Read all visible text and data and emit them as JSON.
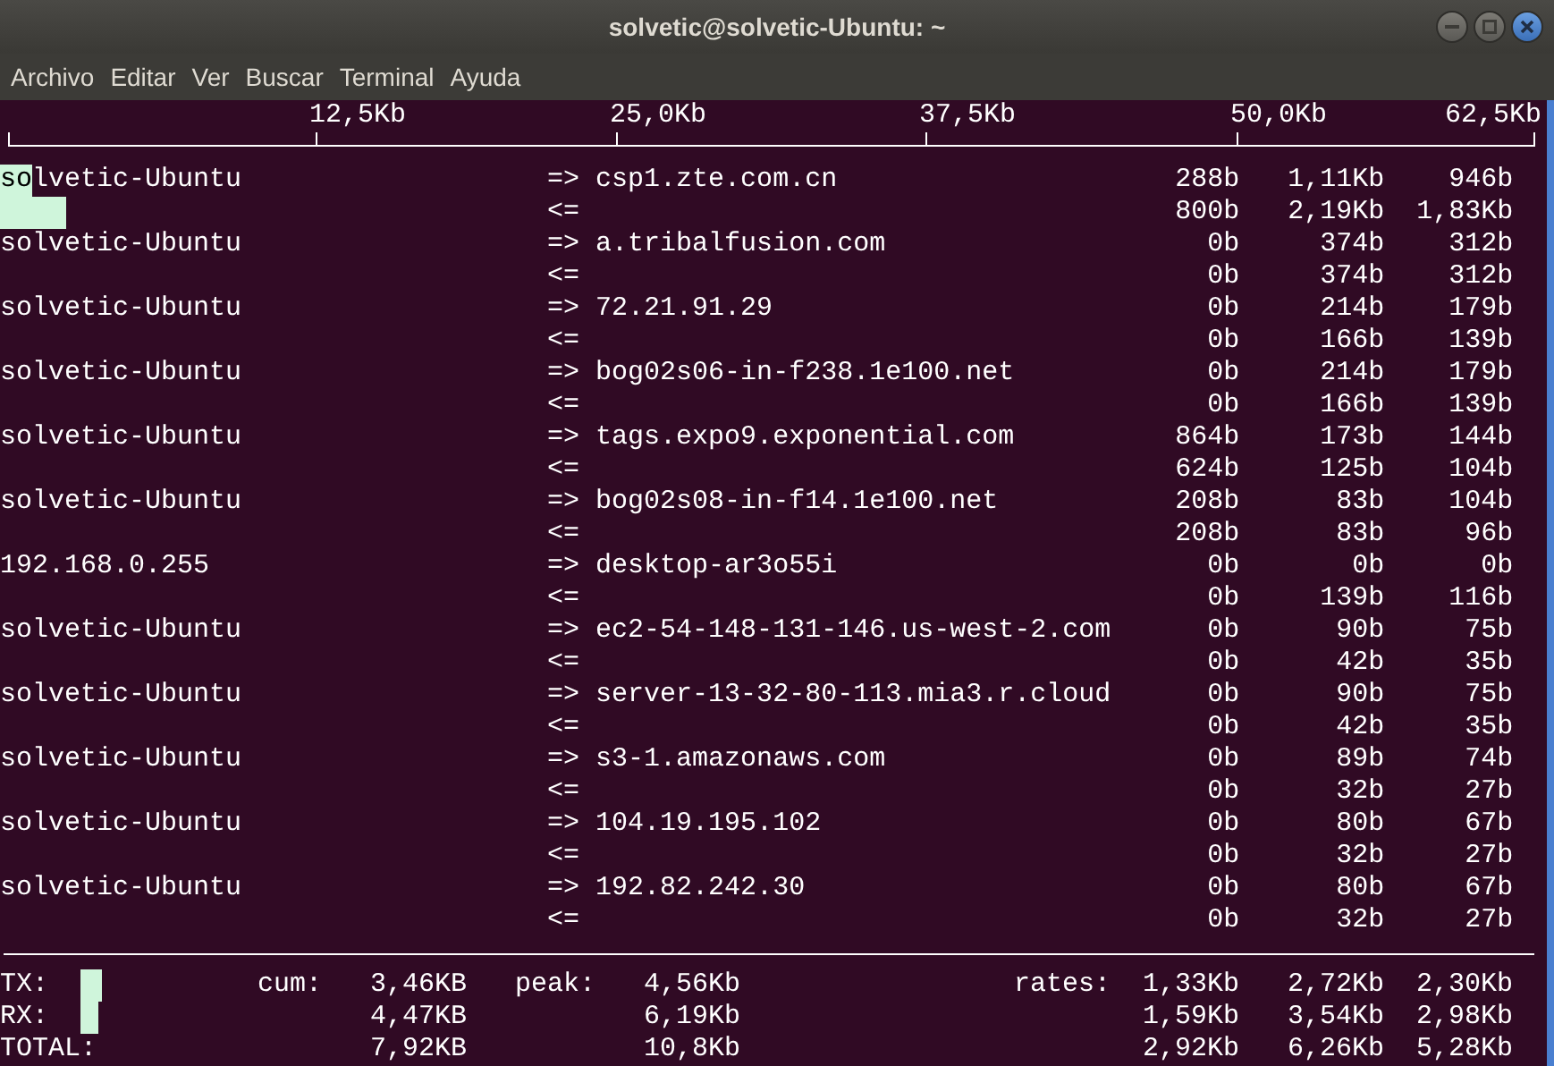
{
  "window": {
    "title": "solvetic@solvetic-Ubuntu: ~"
  },
  "menu": [
    "Archivo",
    "Editar",
    "Ver",
    "Buscar",
    "Terminal",
    "Ayuda"
  ],
  "scale": [
    "12,5Kb",
    "25,0Kb",
    "37,5Kb",
    "50,0Kb",
    "62,5Kb"
  ],
  "flows": [
    {
      "source": "solvetic-Ubuntu",
      "out": {
        "arrow": "=>",
        "destination": "csp1.zte.com.cn",
        "rates": [
          "288b",
          "1,11Kb",
          "946b"
        ],
        "level": 0.021
      },
      "in": {
        "arrow": "<=",
        "rates": [
          "800b",
          "2,19Kb",
          "1,83Kb"
        ],
        "level": 0.043
      }
    },
    {
      "source": "solvetic-Ubuntu",
      "out": {
        "arrow": "=>",
        "destination": "a.tribalfusion.com",
        "rates": [
          "0b",
          "374b",
          "312b"
        ]
      },
      "in": {
        "arrow": "<=",
        "rates": [
          "0b",
          "374b",
          "312b"
        ]
      }
    },
    {
      "source": "solvetic-Ubuntu",
      "out": {
        "arrow": "=>",
        "destination": "72.21.91.29",
        "rates": [
          "0b",
          "214b",
          "179b"
        ]
      },
      "in": {
        "arrow": "<=",
        "rates": [
          "0b",
          "166b",
          "139b"
        ]
      }
    },
    {
      "source": "solvetic-Ubuntu",
      "out": {
        "arrow": "=>",
        "destination": "bog02s06-in-f238.1e100.net",
        "rates": [
          "0b",
          "214b",
          "179b"
        ]
      },
      "in": {
        "arrow": "<=",
        "rates": [
          "0b",
          "166b",
          "139b"
        ]
      }
    },
    {
      "source": "solvetic-Ubuntu",
      "out": {
        "arrow": "=>",
        "destination": "tags.expo9.exponential.com",
        "rates": [
          "864b",
          "173b",
          "144b"
        ]
      },
      "in": {
        "arrow": "<=",
        "rates": [
          "624b",
          "125b",
          "104b"
        ]
      }
    },
    {
      "source": "solvetic-Ubuntu",
      "out": {
        "arrow": "=>",
        "destination": "bog02s08-in-f14.1e100.net",
        "rates": [
          "208b",
          "83b",
          "104b"
        ]
      },
      "in": {
        "arrow": "<=",
        "rates": [
          "208b",
          "83b",
          "96b"
        ]
      }
    },
    {
      "source": "192.168.0.255",
      "out": {
        "arrow": "=>",
        "destination": "desktop-ar3o55i",
        "rates": [
          "0b",
          "0b",
          "0b"
        ]
      },
      "in": {
        "arrow": "<=",
        "rates": [
          "0b",
          "139b",
          "116b"
        ]
      }
    },
    {
      "source": "solvetic-Ubuntu",
      "out": {
        "arrow": "=>",
        "destination": "ec2-54-148-131-146.us-west-2.com",
        "rates": [
          "0b",
          "90b",
          "75b"
        ]
      },
      "in": {
        "arrow": "<=",
        "rates": [
          "0b",
          "42b",
          "35b"
        ]
      }
    },
    {
      "source": "solvetic-Ubuntu",
      "out": {
        "arrow": "=>",
        "destination": "server-13-32-80-113.mia3.r.cloud",
        "rates": [
          "0b",
          "90b",
          "75b"
        ]
      },
      "in": {
        "arrow": "<=",
        "rates": [
          "0b",
          "42b",
          "35b"
        ]
      }
    },
    {
      "source": "solvetic-Ubuntu",
      "out": {
        "arrow": "=>",
        "destination": "s3-1.amazonaws.com",
        "rates": [
          "0b",
          "89b",
          "74b"
        ]
      },
      "in": {
        "arrow": "<=",
        "rates": [
          "0b",
          "32b",
          "27b"
        ]
      }
    },
    {
      "source": "solvetic-Ubuntu",
      "out": {
        "arrow": "=>",
        "destination": "104.19.195.102",
        "rates": [
          "0b",
          "80b",
          "67b"
        ]
      },
      "in": {
        "arrow": "<=",
        "rates": [
          "0b",
          "32b",
          "27b"
        ]
      }
    },
    {
      "source": "solvetic-Ubuntu",
      "out": {
        "arrow": "=>",
        "destination": "192.82.242.30",
        "rates": [
          "0b",
          "80b",
          "67b"
        ]
      },
      "in": {
        "arrow": "<=",
        "rates": [
          "0b",
          "32b",
          "27b"
        ]
      }
    }
  ],
  "totals": [
    {
      "label": "TX:",
      "cum_label": "cum:",
      "cum": "3,46KB",
      "peak_label": "peak:",
      "peak": "4,56Kb",
      "rates_label": "rates:",
      "rates": [
        "1,33Kb",
        "2,72Kb",
        "2,30Kb"
      ],
      "level": 0.014
    },
    {
      "label": "RX:",
      "cum": "4,47KB",
      "peak": "6,19Kb",
      "rates": [
        "1,59Kb",
        "3,54Kb",
        "2,98Kb"
      ],
      "level": 0.012
    },
    {
      "label": "TOTAL:",
      "cum": "7,92KB",
      "peak": "10,8Kb",
      "rates": [
        "2,92Kb",
        "6,26Kb",
        "5,28Kb"
      ]
    }
  ]
}
